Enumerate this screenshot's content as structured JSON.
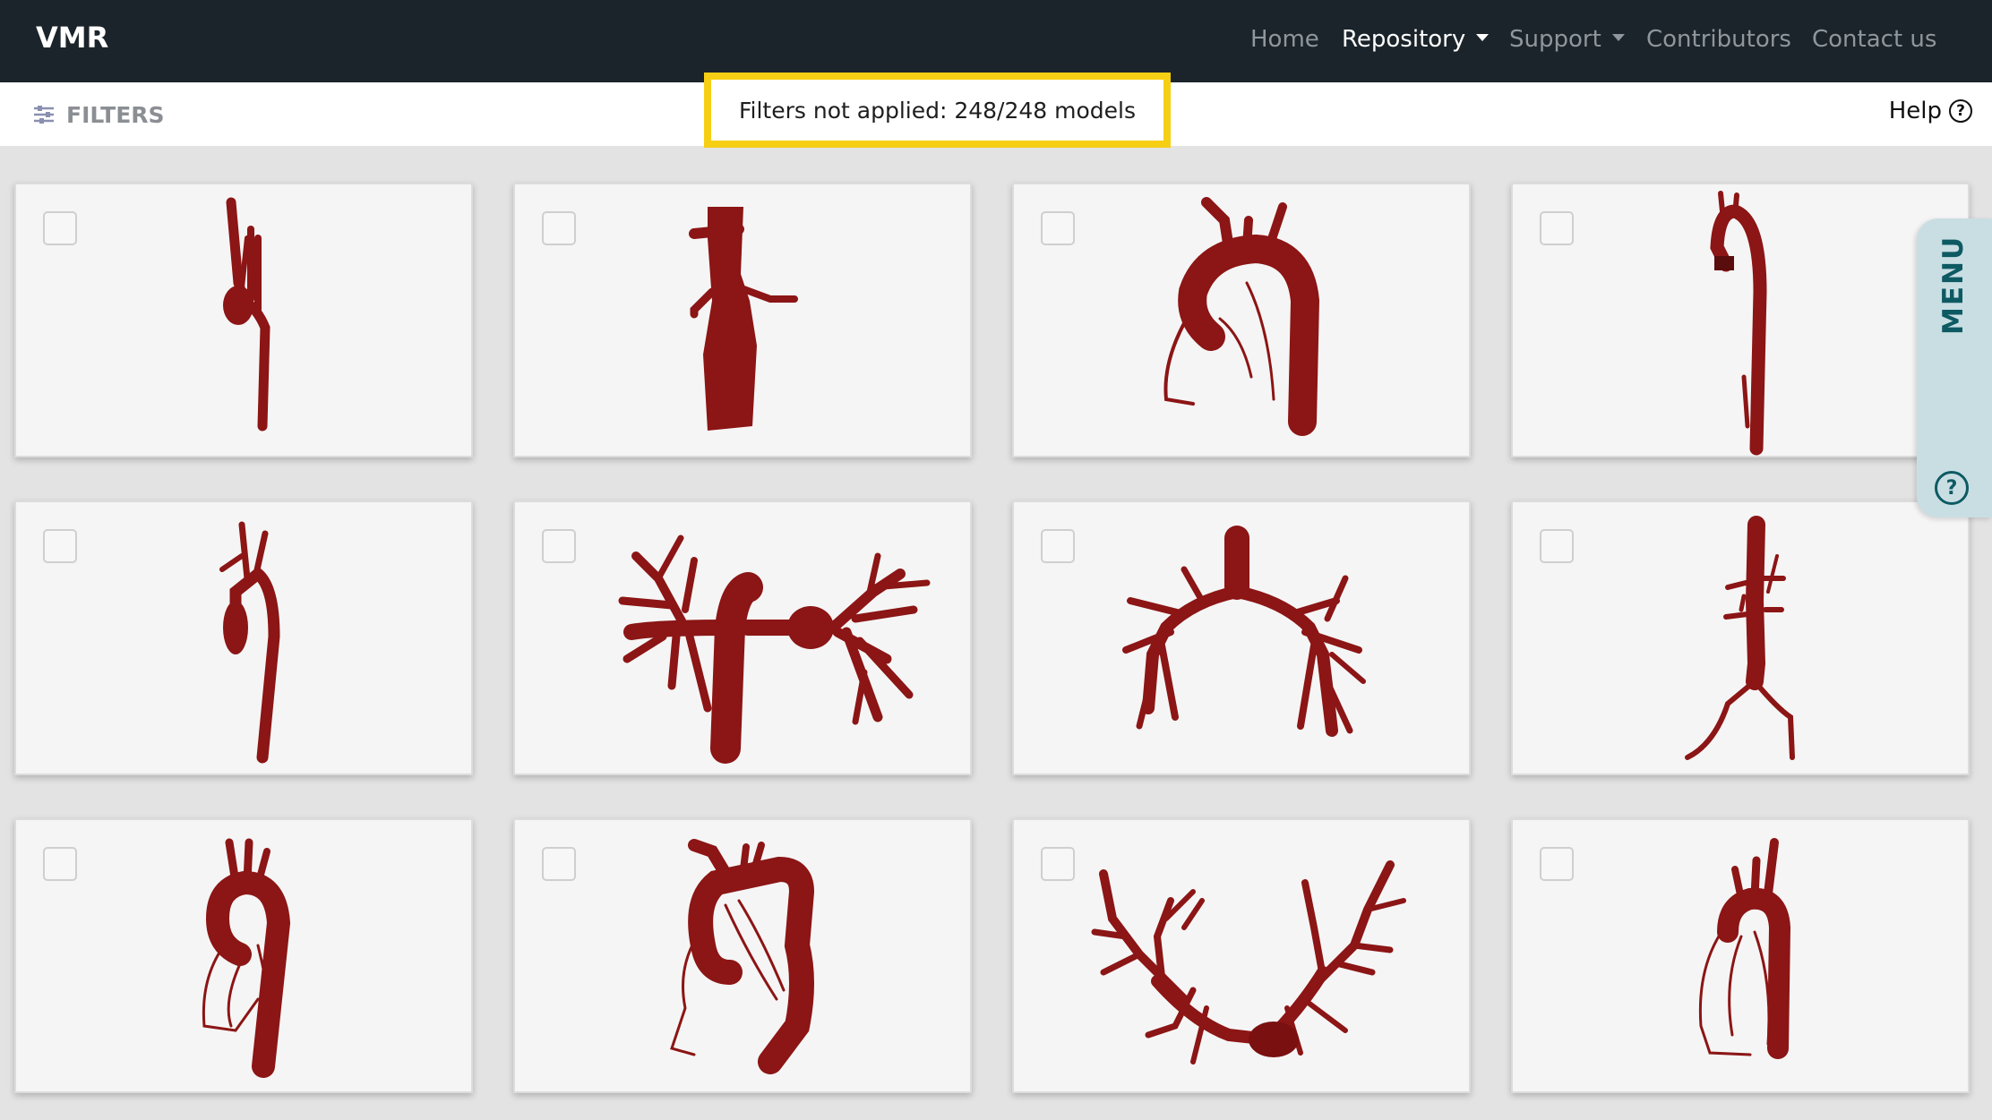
{
  "navbar": {
    "brand": "VMR",
    "items": [
      {
        "label": "Home"
      },
      {
        "label": "Repository"
      },
      {
        "label": "Support"
      },
      {
        "label": "Contributors"
      },
      {
        "label": "Contact us"
      }
    ]
  },
  "filterbar": {
    "filters_label": "FILTERS",
    "status": "Filters not applied: 248/248 models",
    "help_label": "Help"
  },
  "side_menu": {
    "label": "MENU"
  },
  "colors": {
    "navbar_bg": "#1b242a",
    "highlight": "#f6cf14",
    "vessel": "#8c1515",
    "menu_tab": "#c9dee3",
    "menu_text": "#0e5a63"
  },
  "icons": [
    "sliders-icon",
    "help-circle-icon",
    "caret-down-icon",
    "checkbox-icon"
  ],
  "gallery": {
    "model_count_shown": 12,
    "models": [
      {
        "selected": false,
        "kind": "aorta"
      },
      {
        "selected": false,
        "kind": "abdominal-aorta"
      },
      {
        "selected": false,
        "kind": "aortic-arch-coronary"
      },
      {
        "selected": false,
        "kind": "aorta"
      },
      {
        "selected": false,
        "kind": "aorta"
      },
      {
        "selected": false,
        "kind": "pulmonary"
      },
      {
        "selected": false,
        "kind": "pulmonary"
      },
      {
        "selected": false,
        "kind": "aorta-iliac"
      },
      {
        "selected": false,
        "kind": "aortic-arch-coronary"
      },
      {
        "selected": false,
        "kind": "aortic-arch-coronary"
      },
      {
        "selected": false,
        "kind": "pulmonary-tree"
      },
      {
        "selected": false,
        "kind": "aortic-arch-coronary"
      }
    ]
  }
}
